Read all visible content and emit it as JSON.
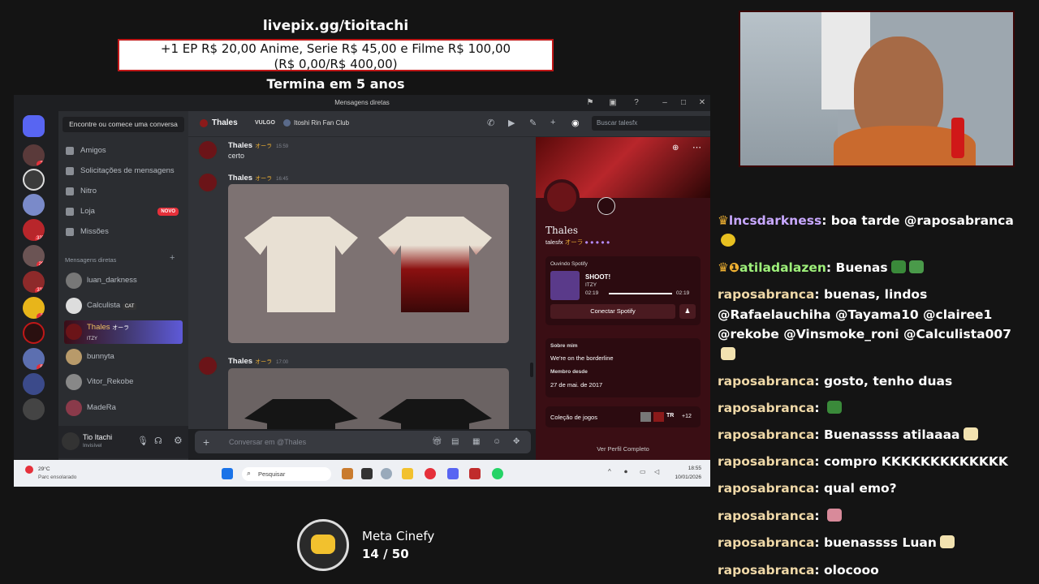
{
  "overlay": {
    "livepix": "livepix.gg/tioitachi",
    "goal_line1": "+1 EP R$ 20,00 Anime, Serie R$ 45,00 e Filme R$ 100,00",
    "goal_line2": "(R$ 0,00/R$ 400,00)",
    "ends": "Termina em 5 anos"
  },
  "discord": {
    "window_title": "Mensagens diretas",
    "search_placeholder": "Encontre ou comece uma conversa",
    "nav": [
      "Amigos",
      "Solicitações de mensagens",
      "Nitro",
      "Loja",
      "Missões"
    ],
    "novo_badge": "NOVO",
    "dm_header": "Mensagens diretas",
    "dms": [
      {
        "name": "luan_darkness"
      },
      {
        "name": "Calculista",
        "tag": "CAT"
      },
      {
        "name": "Thales",
        "tag": "オーラ",
        "status": "ITZY"
      },
      {
        "name": "bunnyta"
      },
      {
        "name": "Vitor_Rekobe"
      },
      {
        "name": "MadeRa"
      }
    ],
    "server_badges": [
      "2",
      "327",
      "28",
      "311",
      "2",
      "8"
    ],
    "user": {
      "name": "Tio Itachi",
      "status": "Invisível"
    },
    "chat_header": {
      "name": "Thales",
      "vulgo": "VULGO",
      "club": "Itoshi Rin Fan Club",
      "search": "Buscar talesfx"
    },
    "messages": [
      {
        "name": "Thales",
        "tag": "オーラ",
        "time": "15:59",
        "text": "certo"
      },
      {
        "name": "Thales",
        "tag": "オーラ",
        "time": "16:45"
      },
      {
        "name": "Thales",
        "tag": "オーラ",
        "time": "17:00"
      }
    ],
    "composer_placeholder": "Conversar em @Thales",
    "profile": {
      "name": "Thales",
      "handle": "talesfx",
      "tag": "オーラ",
      "listening_label": "Ouvindo Spotify",
      "song": "SHOOT!",
      "artist": "ITZY",
      "time_current": "02:19",
      "time_total": "02:19",
      "progress": 1.0,
      "connect_label": "Conectar Spotify",
      "about_label": "Sobre mim",
      "about_text": "We're on the borderline",
      "member_label": "Membro desde",
      "member_date": "27 de mai. de 2017",
      "games_label": "Coleção de jogos",
      "games_more": "+12",
      "games_tag": "TR",
      "view_full": "Ver Perfil Completo"
    }
  },
  "taskbar": {
    "weather_temp": "29°C",
    "weather_desc": "Parc ensolarado",
    "search": "Pesquisar",
    "time": "18:55",
    "date": "10/01/2026"
  },
  "stream_chat": [
    {
      "user": "lncsdarkness",
      "text": "boa tarde @raposabranca",
      "badges": "crown"
    },
    {
      "user": "atiladalazen",
      "text": "Buenas",
      "badges": "crown-1"
    },
    {
      "user": "raposabranca",
      "text": "buenas, lindos @Rafaelauchiha @Tayama10 @clairee1 @rekobe @Vinsmoke_roni @Calculista007"
    },
    {
      "user": "raposabranca",
      "text": "gosto, tenho duas"
    },
    {
      "user": "raposabranca",
      "text": ""
    },
    {
      "user": "raposabranca",
      "text": "Buenassss atilaaaa"
    },
    {
      "user": "raposabranca",
      "text": "compro KKKKKKKKKKKKK"
    },
    {
      "user": "raposabranca",
      "text": "qual emo?"
    },
    {
      "user": "raposabranca",
      "text": ""
    },
    {
      "user": "raposabranca",
      "text": "buenassss Luan"
    },
    {
      "user": "raposabranca",
      "text": "olocooo"
    }
  ],
  "meta": {
    "name": "Meta Cinefy",
    "count": "14 / 50"
  },
  "colors": {
    "accent_red": "#c01818",
    "discord_blurple": "#5865f2",
    "chat_user": "#f0d9a8"
  }
}
